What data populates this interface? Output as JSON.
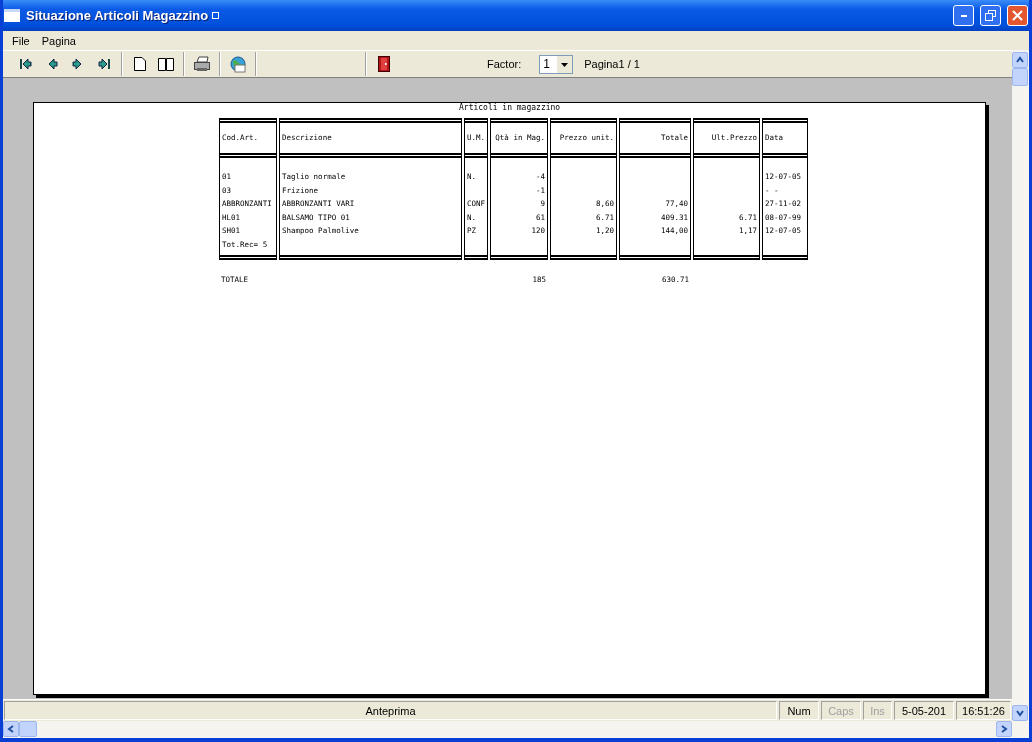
{
  "window": {
    "title": "Situazione Articoli Magazzino"
  },
  "menu": [
    "File",
    "Pagina"
  ],
  "toolbar": {
    "factor_label": "Factor:",
    "factor_value": "1",
    "page_info": "Pagina1 / 1"
  },
  "report": {
    "title": "Articoli in magazzino",
    "columns": [
      {
        "label": "Cod.Art.",
        "kind": "text"
      },
      {
        "label": "Descrizione",
        "kind": "text"
      },
      {
        "label": "U.M.",
        "kind": "text"
      },
      {
        "label": "Qtà in Mag.",
        "kind": "number"
      },
      {
        "label": "Prezzo unit.",
        "kind": "number"
      },
      {
        "label": "Totale",
        "kind": "number"
      },
      {
        "label": "Ult.Prezzo",
        "kind": "number"
      },
      {
        "label": "Data",
        "kind": "text"
      }
    ],
    "rows": [
      {
        "cod_art": "01",
        "descrizione": "Taglio normale",
        "um": "N.",
        "qta": "-4",
        "data": "12-07-05"
      },
      {
        "cod_art": "03",
        "descrizione": "Frizione",
        "qta": "-1",
        "data": "-  -"
      },
      {
        "cod_art": "ABBRONZANTI",
        "descrizione": "ABBRONZANTI VARI",
        "um": "CONF",
        "qta": "9",
        "prezzo_unit": "8,60",
        "totale": "77,40",
        "data": "27-11-02"
      },
      {
        "cod_art": "HL01",
        "descrizione": "BALSAMO TIPO 01",
        "um": "N.",
        "qta": "61",
        "prezzo_unit": "6.71",
        "totale": "409.31",
        "ult_prezzo": "6.71",
        "data": "08-07-99"
      },
      {
        "cod_art": "SH01",
        "descrizione": "Shampoo Palmolive",
        "um": "PZ",
        "qta": "120",
        "prezzo_unit": "1,20",
        "totale": "144,00",
        "ult_prezzo": "1,17",
        "data": "12-07-05"
      }
    ],
    "footer": {
      "cod_art": "Tot.Rec= 5"
    },
    "totals": {
      "cod_art": "TOTALE",
      "qta": "185",
      "totale": "630.71"
    }
  },
  "status_bar": {
    "message": "Anteprima",
    "panels": [
      {
        "text": "Num",
        "disabled": false
      },
      {
        "text": "Caps",
        "disabled": true
      },
      {
        "text": "Ins",
        "disabled": true
      },
      {
        "text": "5-05-201",
        "disabled": false
      },
      {
        "text": "16:51:26",
        "disabled": false
      }
    ]
  }
}
